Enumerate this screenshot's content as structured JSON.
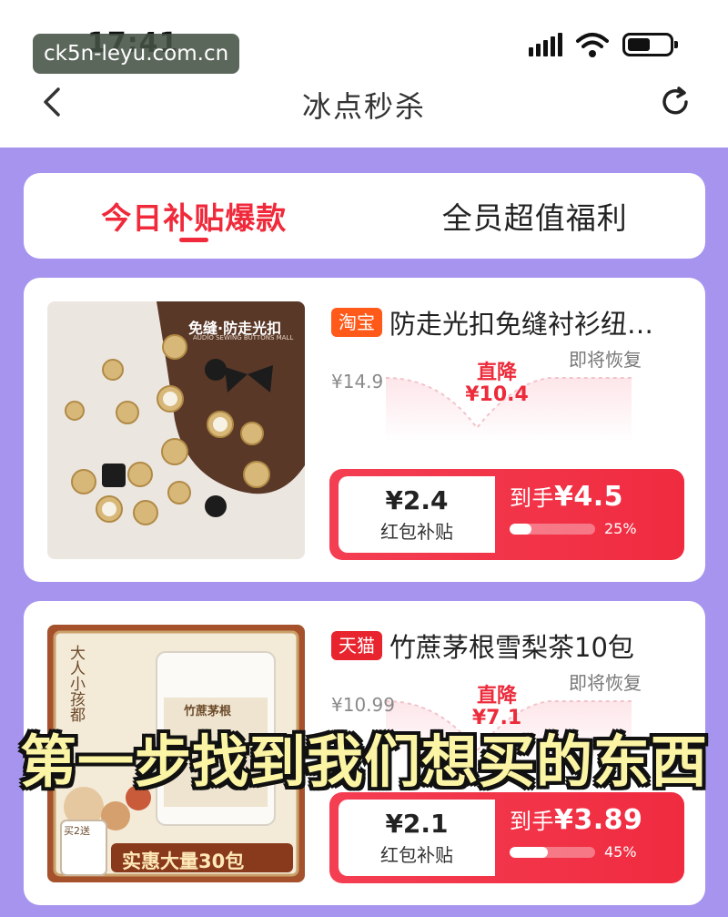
{
  "status_bar": {
    "time": "17:41",
    "watermark": "ck5n-leyu.com.cn"
  },
  "header": {
    "title": "冰点秒杀"
  },
  "tabs": [
    {
      "label": "今日补贴爆款",
      "active": true
    },
    {
      "label": "全员超值福利",
      "active": false
    }
  ],
  "products": [
    {
      "platform": "淘宝",
      "platform_color": "#ff5a1a",
      "title": "防走光扣免缝衬衫纽…",
      "image_text": "免缝·防走光扣",
      "image_subtext": "AUDIO SEWING BUTTONS MALL",
      "original_price": "¥14.9",
      "drop_label": "直降",
      "drop_price": "¥10.4",
      "restore_label": "即将恢复",
      "subsidy_amount": "¥2.4",
      "subsidy_label": "红包补贴",
      "final_prefix": "到手",
      "final_price": "¥4.5",
      "progress_text": "25%",
      "progress_fraction": 0.25
    },
    {
      "platform": "天猫",
      "platform_color": "#e8242f",
      "title": "竹蔗茅根雪梨茶10包",
      "image_text": "实惠大量30包",
      "image_side_text": "大人小孩都",
      "image_pack_text": "竹蔗茅根",
      "image_gift_text": "买2送",
      "original_price": "¥10.99",
      "drop_label": "直降",
      "drop_price": "¥7.1",
      "restore_label": "即将恢复",
      "subsidy_amount": "¥2.1",
      "subsidy_label": "红包补贴",
      "final_prefix": "到手",
      "final_price": "¥3.89",
      "progress_text": "45%",
      "progress_fraction": 0.45
    }
  ],
  "caption": "第一步找到我们想买的东西",
  "icons": {
    "back": "chevron-left-icon",
    "refresh": "refresh-icon"
  }
}
